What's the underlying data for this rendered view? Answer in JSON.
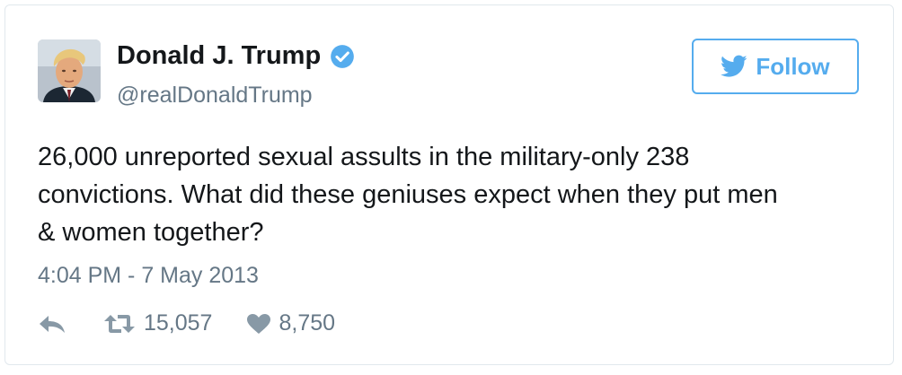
{
  "tweet": {
    "author": {
      "name": "Donald J. Trump",
      "handle": "@realDonaldTrump",
      "verified": true,
      "avatar": "profile-photo"
    },
    "follow_button": {
      "label": "Follow",
      "icon": "twitter-bird-icon",
      "color": "#55acee"
    },
    "text_lines": [
      "26,000 unreported sexual assults in the military-only 238",
      "convictions. What did these geniuses expect when they put men",
      "& women together?"
    ],
    "timestamp": "4:04 PM - 7 May 2013",
    "actions": {
      "reply": {
        "icon": "reply-icon"
      },
      "retweet": {
        "icon": "retweet-icon",
        "count": "15,057"
      },
      "like": {
        "icon": "heart-icon",
        "count": "8,750"
      }
    }
  },
  "colors": {
    "text": "#14171a",
    "secondary": "#657786",
    "accent": "#55acee",
    "border": "#e1e8ed",
    "action_icon": "#8899a6"
  }
}
